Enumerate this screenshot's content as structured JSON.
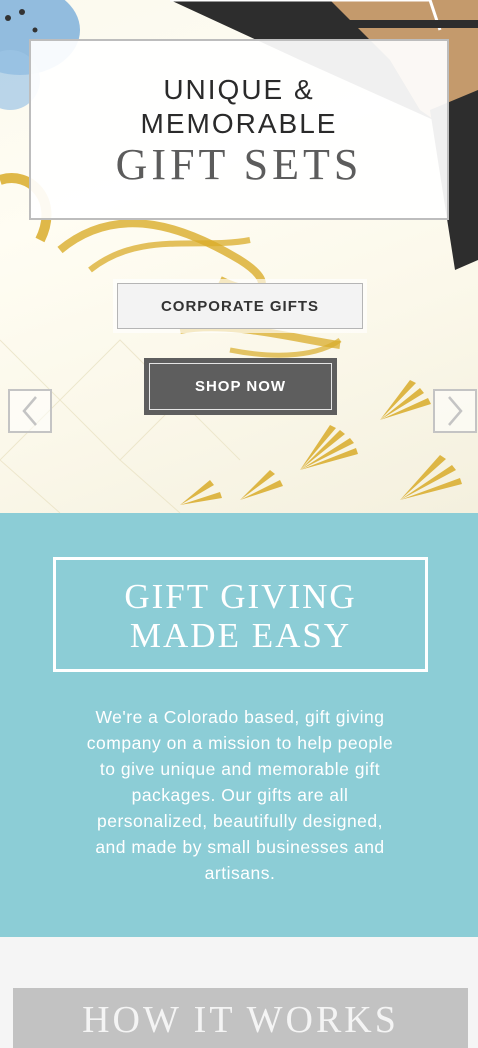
{
  "hero": {
    "title_line1": "UNIQUE &",
    "title_line2": "MEMORABLE",
    "title_line3": "GIFT SETS",
    "corporate_button": "CORPORATE GIFTS",
    "shop_button": "SHOP NOW",
    "prev_icon": "chevron-left-icon",
    "next_icon": "chevron-right-icon"
  },
  "intro": {
    "heading_line1": "GIFT GIVING",
    "heading_line2": "MADE EASY",
    "lines": [
      "We're a Colorado based, gift giving",
      "company on a mission to help people",
      "to give unique and memorable gift",
      "packages. Our gifts are all",
      "personalized, beautifully designed,",
      "and made by small businesses and",
      "artisans."
    ]
  },
  "how_it_works": {
    "title": "HOW IT WORKS"
  },
  "colors": {
    "teal": "#8ccdd6",
    "dark_button": "#5e5e5e",
    "gold": "#d9ac2a",
    "gray_banner": "#c2c2c2"
  }
}
